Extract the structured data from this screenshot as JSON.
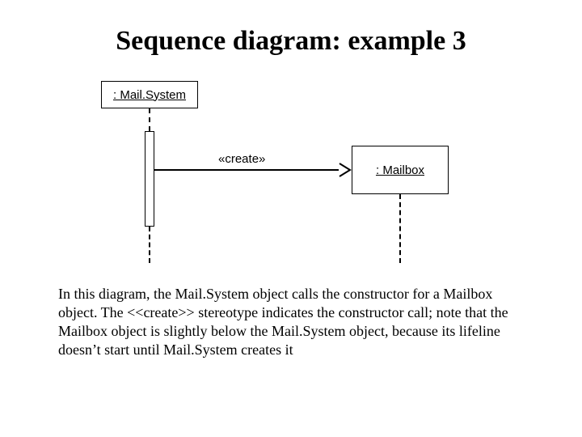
{
  "title": "Sequence diagram: example 3",
  "diagram": {
    "object_left": {
      "label": ": Mail.System"
    },
    "object_right": {
      "label": ": Mailbox"
    },
    "message": {
      "stereotype": "«create»"
    }
  },
  "description": "In this diagram, the Mail.System object calls the constructor for a Mailbox object.  The <<create>> stereotype indicates the constructor call; note that the Mailbox object is slightly below the Mail.System object, because its lifeline doesn’t start until Mail.System creates it"
}
